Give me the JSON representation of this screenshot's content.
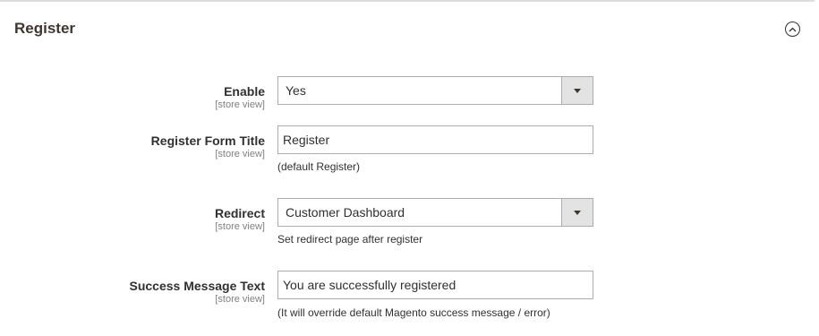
{
  "section": {
    "title": "Register"
  },
  "fields": {
    "enable": {
      "label": "Enable",
      "scope": "[store view]",
      "value": "Yes"
    },
    "form_title": {
      "label": "Register Form Title",
      "scope": "[store view]",
      "value": "Register",
      "note": "(default Register)"
    },
    "redirect": {
      "label": "Redirect",
      "scope": "[store view]",
      "value": "Customer Dashboard",
      "note": "Set redirect page after register"
    },
    "success_message": {
      "label": "Success Message Text",
      "scope": "[store view]",
      "value": "You are successfully registered",
      "note": "(It will override default Magento success message / error)"
    }
  },
  "icons": {
    "collapse": "chevron-up-circle-icon",
    "select_arrow": "caret-down-icon"
  }
}
